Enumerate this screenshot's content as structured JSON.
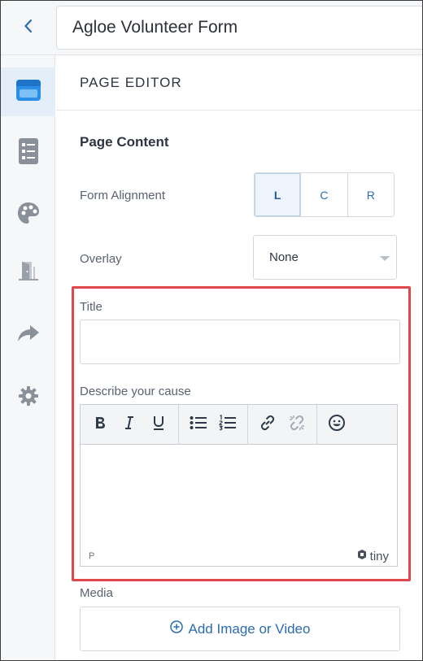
{
  "header": {
    "title": "Agloe Volunteer Form",
    "back_icon": "chevron-left-icon"
  },
  "sidebar": {
    "items": [
      {
        "name": "page-editor",
        "icon": "browser-window-icon",
        "active": true
      },
      {
        "name": "form-fields",
        "icon": "list-icon",
        "active": false
      },
      {
        "name": "theme",
        "icon": "palette-icon",
        "active": false
      },
      {
        "name": "exit-page",
        "icon": "door-icon",
        "active": false
      },
      {
        "name": "share",
        "icon": "share-arrow-icon",
        "active": false
      },
      {
        "name": "settings",
        "icon": "gear-icon",
        "active": false
      }
    ]
  },
  "main": {
    "section_title": "PAGE EDITOR",
    "content_title": "Page Content",
    "alignment": {
      "label": "Form Alignment",
      "options": [
        "L",
        "C",
        "R"
      ],
      "selected": "L"
    },
    "overlay": {
      "label": "Overlay",
      "value": "None"
    },
    "title_field": {
      "label": "Title",
      "value": ""
    },
    "cause_field": {
      "label": "Describe your cause",
      "toolbar": [
        "bold-icon",
        "italic-icon",
        "underline-icon",
        "bullet-list-icon",
        "numbered-list-icon",
        "link-icon",
        "unlink-icon",
        "emoji-icon"
      ],
      "path": "P",
      "brand": "tiny"
    },
    "media": {
      "label": "Media",
      "button_label": "Add Image or Video"
    }
  },
  "colors": {
    "accent": "#2b6cb0",
    "highlight": "#e0474c",
    "active_bg": "#e3eef9"
  }
}
